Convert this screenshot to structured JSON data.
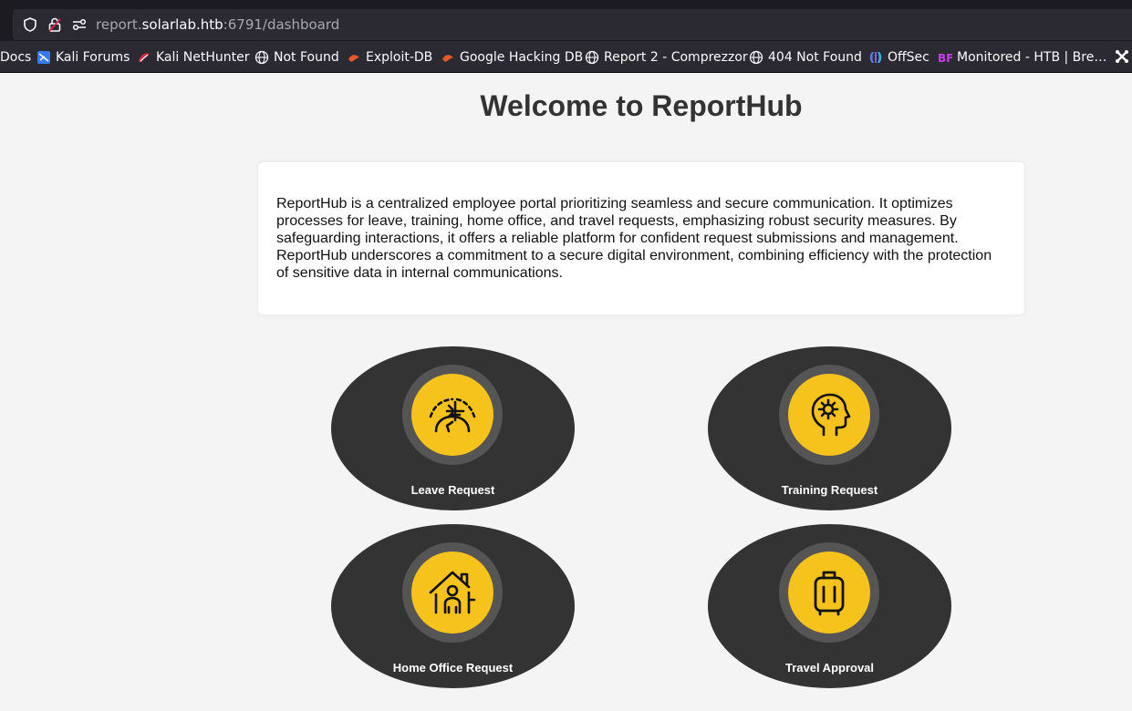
{
  "browser": {
    "url_prefix": "report.",
    "url_host": "solarlab.htb",
    "url_suffix": ":6791/dashboard",
    "bookmarks": [
      {
        "label": "Docs",
        "icon": "none"
      },
      {
        "label": "Kali Forums",
        "icon": "kali-forums-icon"
      },
      {
        "label": "Kali NetHunter",
        "icon": "kali-nethunter-icon"
      },
      {
        "label": "Not Found",
        "icon": "globe-icon"
      },
      {
        "label": "Exploit-DB",
        "icon": "exploit-db-icon"
      },
      {
        "label": "Google Hacking DB",
        "icon": "ghdb-icon"
      },
      {
        "label": "Report 2 - Comprezzor",
        "icon": "globe-icon"
      },
      {
        "label": "404 Not Found",
        "icon": "globe-icon"
      },
      {
        "label": "OffSec",
        "icon": "offsec-icon"
      },
      {
        "label": "Monitored - HTB | Bre…",
        "icon": "bf-icon"
      }
    ]
  },
  "page": {
    "title": "Welcome to ReportHub",
    "intro": "ReportHub is a centralized employee portal prioritizing seamless and secure communication. It optimizes processes for leave, training, home office, and travel requests, emphasizing robust security measures. By safeguarding interactions, it offers a reliable platform for confident request submissions and management. ReportHub underscores a commitment to a secure digital environment, combining efficiency with the protection of sensitive data in internal communications."
  },
  "tiles": [
    {
      "label": "Leave Request",
      "icon": "airplane-globe-icon"
    },
    {
      "label": "Training Request",
      "icon": "head-gear-icon"
    },
    {
      "label": "Home Office Request",
      "icon": "house-person-icon"
    },
    {
      "label": "Travel Approval",
      "icon": "luggage-icon"
    }
  ],
  "colors": {
    "accent": "#f6c21c",
    "tile_bg": "#333333",
    "ring": "#555555",
    "page_bg": "#f4f4f4"
  }
}
